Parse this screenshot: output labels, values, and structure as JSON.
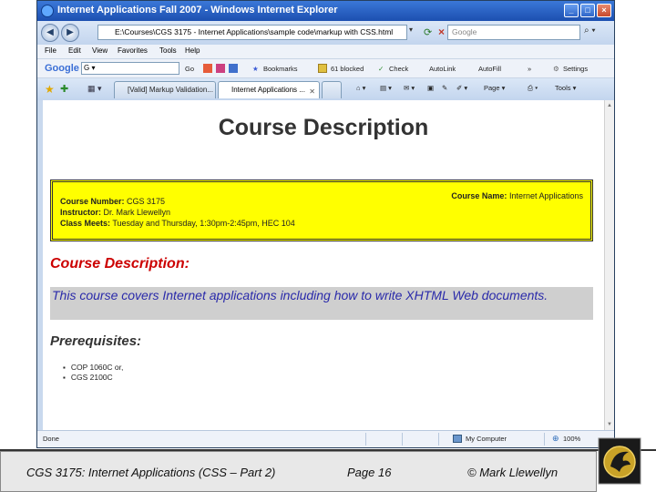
{
  "window": {
    "title": "Internet Applications Fall 2007 - Windows Internet Explorer",
    "controls": [
      "_",
      "□",
      "×"
    ]
  },
  "address_bar": {
    "url": "E:\\Courses\\CGS 3175 - Internet Applications\\sample code\\markup with CSS.html",
    "search_placeholder": "Google"
  },
  "menu": [
    "File",
    "Edit",
    "View",
    "Favorites",
    "Tools",
    "Help"
  ],
  "google_toolbar": {
    "logo": "Google",
    "go_label": "Go",
    "bookmarks": "Bookmarks",
    "blocked": "61 blocked",
    "check": "Check",
    "autolink": "AutoLink",
    "autofill": "AutoFill",
    "more": "»",
    "settings": "Settings"
  },
  "tabs": [
    {
      "label": "[Valid] Markup Validation..."
    },
    {
      "label": "Internet Applications ..."
    }
  ],
  "tab_toolbar": {
    "page": "Page",
    "tools": "Tools"
  },
  "page": {
    "heading": "Course Description",
    "info": {
      "number_label": "Course Number:",
      "number_value": " CGS 3175",
      "instructor_label": "Instructor:",
      "instructor_value": " Dr. Mark Llewellyn",
      "meets_label": "Class Meets:",
      "meets_value": " Tuesday and Thursday, 1:30pm-2:45pm, HEC 104",
      "name_label": "Course Name:",
      "name_value": " Internet Applications"
    },
    "description_heading": "Course Description:",
    "description_text": "This course covers Internet applications including how to write XHTML Web documents.",
    "prerequisites_heading": "Prerequisites:",
    "prerequisites": [
      "COP 1060C or,",
      "CGS 2100C"
    ]
  },
  "status_bar": {
    "status": "Done",
    "zone": "My Computer",
    "zoom": "100%"
  },
  "footer": {
    "course": "CGS 3175: Internet Applications (CSS – Part 2)",
    "page": "Page 16",
    "author": "© Mark Llewellyn"
  },
  "colors": {
    "info_box": "#ffff00",
    "description_heading": "#cc0000",
    "description_text": "#2a2aaa",
    "description_band": "#cfcfcf"
  }
}
